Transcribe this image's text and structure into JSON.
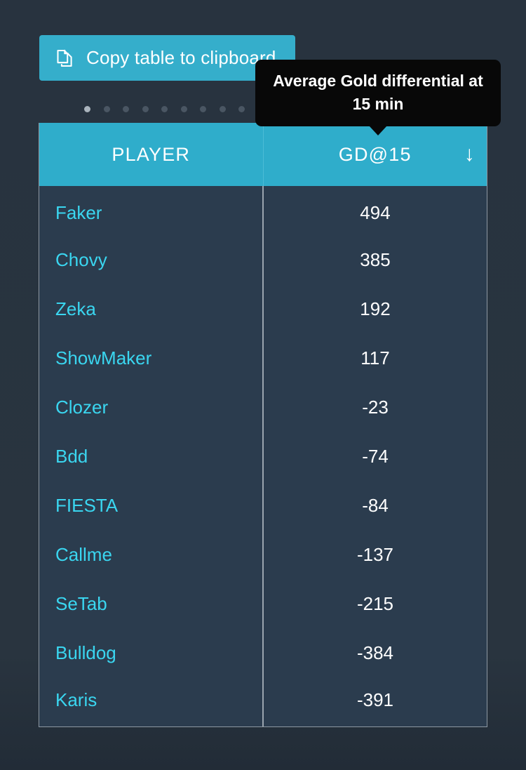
{
  "toolbar": {
    "copy_label": "Copy table to clipboard",
    "copy_icon": "copy-icon"
  },
  "tooltip": {
    "text": "Average Gold differential at 15 min"
  },
  "carousel": {
    "prev_icon": "triangle-left-icon",
    "next_icon": "triangle-right-icon",
    "dot_count": 16,
    "active_dot_index": 0
  },
  "table": {
    "columns": [
      "PLAYER",
      "GD@15"
    ],
    "sort_column": "GD@15",
    "sort_direction_icon": "↓",
    "rows": [
      {
        "player": "Faker",
        "value": "494"
      },
      {
        "player": "Chovy",
        "value": "385"
      },
      {
        "player": "Zeka",
        "value": "192"
      },
      {
        "player": "ShowMaker",
        "value": "117"
      },
      {
        "player": "Clozer",
        "value": "-23"
      },
      {
        "player": "Bdd",
        "value": "-74"
      },
      {
        "player": "FIESTA",
        "value": "-84"
      },
      {
        "player": "Callme",
        "value": "-137"
      },
      {
        "player": "SeTab",
        "value": "-215"
      },
      {
        "player": "Bulldog",
        "value": "-384"
      },
      {
        "player": "Karis",
        "value": "-391"
      }
    ]
  },
  "colors": {
    "page_bg": "#27323f",
    "accent_teal": "#35aecb",
    "header_teal": "#2fadcb",
    "table_bg": "#2b3c4e",
    "link_cyan": "#3ad6f0",
    "tooltip_bg": "#080808",
    "border_grey": "#8e99a3"
  },
  "chart_data": {
    "type": "table",
    "title": "Average Gold differential at 15 min",
    "categories": [
      "Faker",
      "Chovy",
      "Zeka",
      "ShowMaker",
      "Clozer",
      "Bdd",
      "FIESTA",
      "Callme",
      "SeTab",
      "Bulldog",
      "Karis"
    ],
    "values": [
      494,
      385,
      192,
      117,
      -23,
      -74,
      -84,
      -137,
      -215,
      -384,
      -391
    ],
    "xlabel": "PLAYER",
    "ylabel": "GD@15",
    "sorted": "descending"
  }
}
